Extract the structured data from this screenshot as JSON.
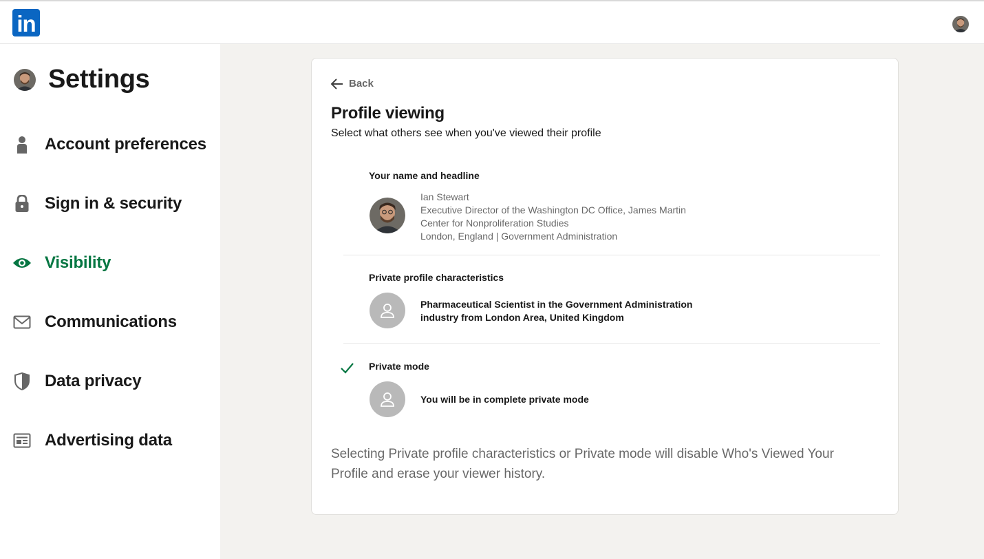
{
  "app": {
    "logo_text": "in",
    "brand_color": "#0a66c2",
    "accent_color": "#057642"
  },
  "sidebar": {
    "title": "Settings",
    "items": [
      {
        "label": "Account preferences",
        "icon": "person-icon",
        "active": false
      },
      {
        "label": "Sign in & security",
        "icon": "lock-icon",
        "active": false
      },
      {
        "label": "Visibility",
        "icon": "eye-icon",
        "active": true
      },
      {
        "label": "Communications",
        "icon": "envelope-icon",
        "active": false
      },
      {
        "label": "Data privacy",
        "icon": "shield-icon",
        "active": false
      },
      {
        "label": "Advertising data",
        "icon": "ad-icon",
        "active": false
      }
    ]
  },
  "card": {
    "back_label": "Back",
    "title": "Profile viewing",
    "subtitle": "Select what others see when you've viewed their profile",
    "options": [
      {
        "title": "Your name and headline",
        "lines": [
          "Ian Stewart",
          "Executive Director of the Washington DC Office, James Martin",
          "Center for Nonproliferation Studies",
          "London, England | Government Administration"
        ],
        "selected": false
      },
      {
        "title": "Private profile characteristics",
        "lines": [
          "Pharmaceutical Scientist in the Government Administration",
          "industry from London Area, United Kingdom"
        ],
        "selected": false
      },
      {
        "title": "Private mode",
        "lines": [
          "You will be in complete private mode"
        ],
        "selected": true
      }
    ],
    "note": "Selecting Private profile characteristics or Private mode will disable Who's Viewed Your Profile and erase your viewer history."
  }
}
